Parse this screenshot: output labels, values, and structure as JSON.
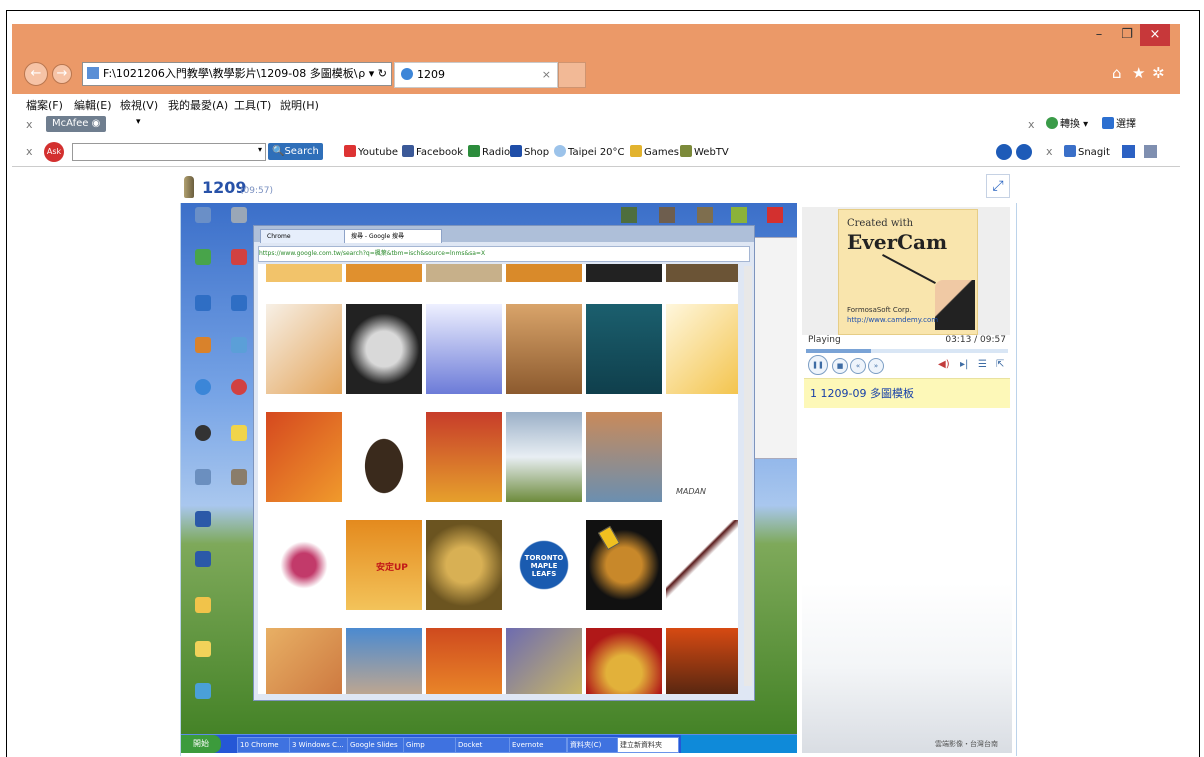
{
  "window": {
    "minimize": "–",
    "maximize": "❐",
    "close": "×"
  },
  "browser": {
    "address": "F:\\1021206入門教學\\教學影片\\1209-08 多圖模板\\n( ",
    "address_icons": "ρ ▾ ↻",
    "tab_title": "1209",
    "tab_close": "×",
    "right_icons": {
      "home": "⌂",
      "favorites": "★",
      "settings": "✲"
    }
  },
  "menu": [
    "檔案(F)",
    "編輯(E)",
    "檢視(V)",
    "我的最愛(A)",
    "工具(T)",
    "說明(H)"
  ],
  "toolbar1": {
    "mcafee": "McAfee",
    "right_items": [
      "轉換",
      "選擇"
    ]
  },
  "toolbar2": {
    "search_button": "Search",
    "links": [
      "Youtube",
      "Facebook",
      "Radio",
      "Shop",
      "Taipei 20°C",
      "Games",
      "WebTV"
    ],
    "snagit": "Snagit"
  },
  "player": {
    "title": "1209",
    "duration_label": "(09:57)",
    "status": "Playing",
    "time": "03:13 / 09:57",
    "progress": 0.323,
    "playlist": [
      "1  1209-09 多圖模板"
    ]
  },
  "evercam": {
    "line1": "Created with",
    "line2": "EverCam",
    "company": "FormosaSoft Corp.",
    "url": "http://www.camdemy.com"
  },
  "video": {
    "chrome_tabs": [
      "Chrome",
      "搜尋 - Google 搜尋"
    ],
    "chrome_url": "https://www.google.com.tw/search?q=楓葉&tbm=isch&source=lnms&sa=X",
    "taskbar_start": "開始",
    "taskbar_items": [
      "10 Chrome",
      "3 Windows C...",
      "Google Slides",
      "Gimp",
      "Docket",
      "Evernote",
      "資料夾(C)",
      "建立新資料夾"
    ],
    "thumb_texts": {
      "madan": "MADAN",
      "maple_leafs": "TORONTO MAPLE LEAFS",
      "anding": "安定UP"
    },
    "watermark": "雲端影像・台灣台南"
  },
  "colors": {
    "titlebar": "#eb9968",
    "close_button": "#c7383a",
    "playlist_bg": "#fdf8b8",
    "link_blue": "#1840a8"
  }
}
